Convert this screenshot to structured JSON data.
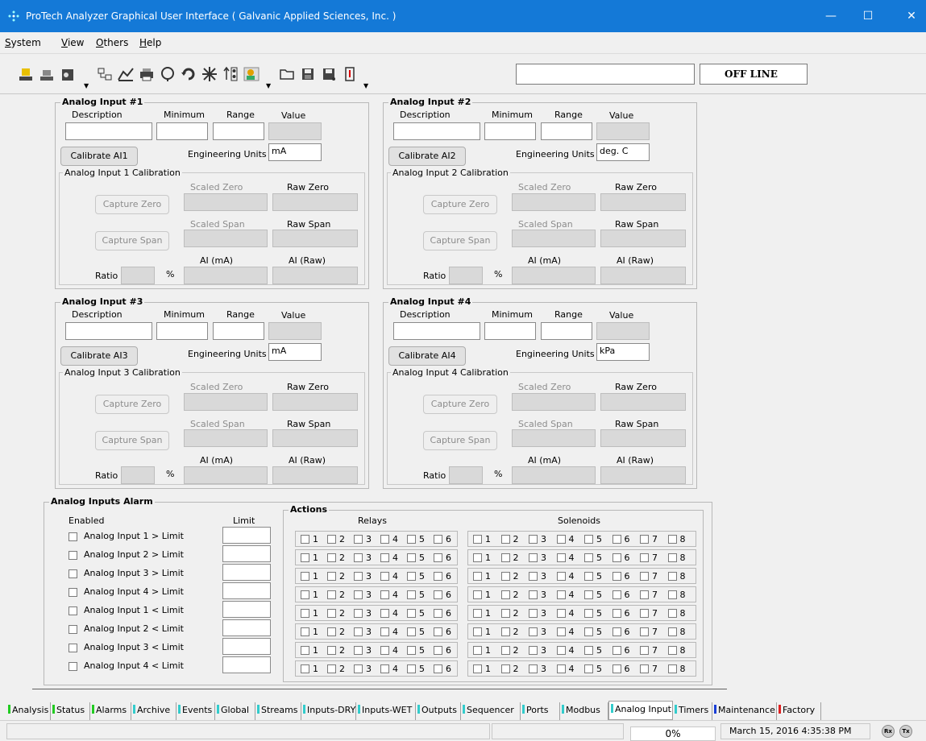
{
  "window": {
    "title": "ProTech Analyzer Graphical User Interface  ( Galvanic Applied Sciences, Inc. )",
    "minimize": "—",
    "maximize": "☐",
    "close": "✕"
  },
  "menu": {
    "items": [
      "System",
      "View",
      "Others",
      "Help"
    ]
  },
  "toolbar": {
    "status": "OFF LINE",
    "input_value": ""
  },
  "labels": {
    "description": "Description",
    "minimum": "Minimum",
    "range": "Range",
    "value": "Value",
    "eng_units": "Engineering Units",
    "capture_zero": "Capture Zero",
    "capture_span": "Capture Span",
    "scaled_zero": "Scaled Zero",
    "raw_zero": "Raw Zero",
    "scaled_span": "Scaled Span",
    "raw_span": "Raw Span",
    "ai_ma": "AI (mA)",
    "ai_raw": "AI (Raw)",
    "ratio": "Ratio",
    "percent": "%"
  },
  "analog_inputs": [
    {
      "title": "Analog Input #1",
      "calibrate": "Calibrate AI1",
      "units": "mA",
      "cal_title": "Analog Input 1 Calibration"
    },
    {
      "title": "Analog Input #2",
      "calibrate": "Calibrate AI2",
      "units": "deg. C",
      "cal_title": "Analog Input 2 Calibration"
    },
    {
      "title": "Analog Input #3",
      "calibrate": "Calibrate AI3",
      "units": "mA",
      "cal_title": "Analog Input 3 Calibration"
    },
    {
      "title": "Analog Input #4",
      "calibrate": "Calibrate AI4",
      "units": "kPa",
      "cal_title": "Analog Input 4 Calibration"
    }
  ],
  "alarm": {
    "title": "Analog Inputs Alarm",
    "enabled_label": "Enabled",
    "limit_label": "Limit",
    "actions_label": "Actions",
    "relays_label": "Relays",
    "solenoids_label": "Solenoids",
    "rows": [
      "Analog Input 1 > Limit",
      "Analog Input 2 > Limit",
      "Analog Input 3 > Limit",
      "Analog Input 4 > Limit",
      "Analog Input 1 < Limit",
      "Analog Input 2 < Limit",
      "Analog Input 3 < Limit",
      "Analog Input 4 < Limit"
    ],
    "relay_numbers": [
      "1",
      "2",
      "3",
      "4",
      "5",
      "6"
    ],
    "solenoid_numbers": [
      "1",
      "2",
      "3",
      "4",
      "5",
      "6",
      "7",
      "8"
    ]
  },
  "tabs": [
    {
      "label": "Analysis",
      "color": "#22cc22"
    },
    {
      "label": "Status",
      "color": "#22cc22"
    },
    {
      "label": "Alarms",
      "color": "#22cc22"
    },
    {
      "label": "Archive",
      "color": "#33cccc"
    },
    {
      "label": "Events",
      "color": "#33cccc"
    },
    {
      "label": "Global",
      "color": "#33cccc"
    },
    {
      "label": "Streams",
      "color": "#33cccc"
    },
    {
      "label": "Inputs-DRY",
      "color": "#33cccc"
    },
    {
      "label": "Inputs-WET",
      "color": "#33cccc"
    },
    {
      "label": "Outputs",
      "color": "#33cccc"
    },
    {
      "label": "Sequencer",
      "color": "#33cccc"
    },
    {
      "label": "Ports",
      "color": "#33cccc"
    },
    {
      "label": "Modbus",
      "color": "#33cccc"
    },
    {
      "label": "Analog Input",
      "color": "#33cccc",
      "active": true
    },
    {
      "label": "Timers",
      "color": "#33cccc"
    },
    {
      "label": "Maintenance",
      "color": "#1a3fd6"
    },
    {
      "label": "Factory",
      "color": "#e02020"
    }
  ],
  "statusbar": {
    "progress": "0%",
    "datetime": "March 15, 2016 4:35:38 PM",
    "rx": "Rx",
    "tx": "Tx"
  }
}
